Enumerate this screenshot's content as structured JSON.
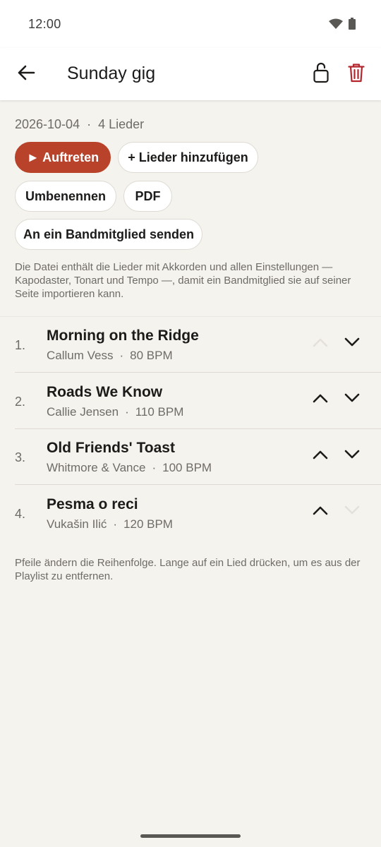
{
  "status_bar": {
    "time": "12:00"
  },
  "app_bar": {
    "title": "Sunday gig",
    "icons": [
      "arrow-back-icon",
      "lock-open-icon",
      "trash-icon"
    ],
    "delete_color": "#b3262e"
  },
  "playlist": {
    "date": "2026-10-04",
    "song_count": "4 Lieder",
    "separator": "·"
  },
  "actions": {
    "perform": "► Auftreten",
    "add_songs": "+ Lieder hinzufügen",
    "rename": "Umbenennen",
    "pdf": "PDF",
    "send": "An ein Bandmitglied senden",
    "accent_color": "#b8432a"
  },
  "hint_top": "Die Datei enthält die Lieder mit Akkorden und allen Einstellungen — Kapodaster, Tonart und Tempo —, damit ein Bandmitglied sie auf seiner Seite importieren kann.",
  "songs": [
    {
      "number": "1.",
      "title": "Morning on the Ridge",
      "artist": "Callum Vess",
      "tempo": "80 BPM",
      "up_enabled": false,
      "down_enabled": true
    },
    {
      "number": "2.",
      "title": "Roads We Know",
      "artist": "Callie Jensen",
      "tempo": "110 BPM",
      "up_enabled": true,
      "down_enabled": true
    },
    {
      "number": "3.",
      "title": "Old Friends' Toast",
      "artist": "Whitmore & Vance",
      "tempo": "100 BPM",
      "up_enabled": true,
      "down_enabled": true
    },
    {
      "number": "4.",
      "title": "Pesma o reci",
      "artist": "Vukašin Ilić",
      "tempo": "120 BPM",
      "up_enabled": true,
      "down_enabled": false
    }
  ],
  "hint_bottom": "Pfeile ändern die Reihenfolge. Lange auf ein Lied drücken, um es aus der Playlist zu entfernen."
}
